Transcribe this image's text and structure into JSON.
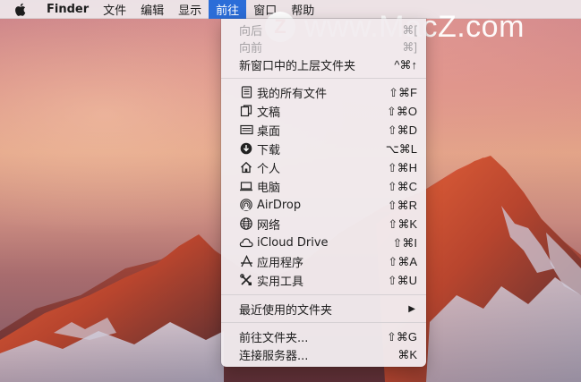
{
  "menubar": {
    "items": [
      {
        "label": "Finder"
      },
      {
        "label": "文件"
      },
      {
        "label": "编辑"
      },
      {
        "label": "显示"
      },
      {
        "label": "前往"
      },
      {
        "label": "窗口"
      },
      {
        "label": "帮助"
      }
    ]
  },
  "watermark": {
    "logo": "Z",
    "text": "www.MacZ.com"
  },
  "menu": {
    "items": [
      {
        "label": "向后",
        "shortcut": "⌘[",
        "disabled": true
      },
      {
        "label": "向前",
        "shortcut": "⌘]",
        "disabled": true
      },
      {
        "label": "新窗口中的上层文件夹",
        "shortcut": "^⌘↑"
      },
      {
        "label": "我的所有文件",
        "shortcut": "⇧⌘F",
        "icon": "all-files-icon"
      },
      {
        "label": "文稿",
        "shortcut": "⇧⌘O",
        "icon": "documents-icon"
      },
      {
        "label": "桌面",
        "shortcut": "⇧⌘D",
        "icon": "desktop-icon"
      },
      {
        "label": "下载",
        "shortcut": "⌥⌘L",
        "icon": "downloads-icon"
      },
      {
        "label": "个人",
        "shortcut": "⇧⌘H",
        "icon": "home-icon"
      },
      {
        "label": "电脑",
        "shortcut": "⇧⌘C",
        "icon": "computer-icon"
      },
      {
        "label": "AirDrop",
        "shortcut": "⇧⌘R",
        "icon": "airdrop-icon"
      },
      {
        "label": "网络",
        "shortcut": "⇧⌘K",
        "icon": "network-icon"
      },
      {
        "label": "iCloud Drive",
        "shortcut": "⇧⌘I",
        "icon": "icloud-icon"
      },
      {
        "label": "应用程序",
        "shortcut": "⇧⌘A",
        "icon": "applications-icon"
      },
      {
        "label": "实用工具",
        "shortcut": "⇧⌘U",
        "icon": "utilities-icon"
      },
      {
        "label": "最近使用的文件夹",
        "submenu_arrow": "▶"
      },
      {
        "label": "前往文件夹...",
        "shortcut": "⇧⌘G"
      },
      {
        "label": "连接服务器...",
        "shortcut": "⌘K"
      }
    ]
  },
  "colors": {
    "menu_highlight": "#2b6dd8",
    "disabled_text": "#a5a2a5"
  }
}
